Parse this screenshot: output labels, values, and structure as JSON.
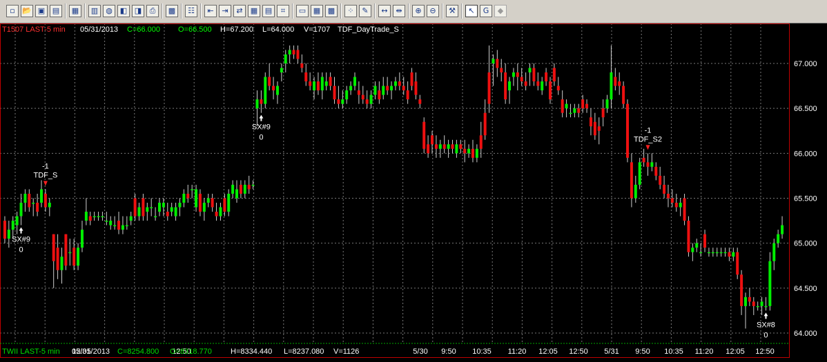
{
  "toolbar": {
    "icons": [
      {
        "name": "new-document-icon",
        "glyph": "▫"
      },
      {
        "name": "open-folder-icon",
        "glyph": "📂"
      },
      {
        "name": "save-workspace-icon",
        "glyph": "▣"
      },
      {
        "name": "workspace-folder-icon",
        "glyph": "▤"
      },
      {
        "name": "chart-window-icon",
        "glyph": "▦"
      },
      {
        "name": "bar-chart-icon",
        "glyph": "▥"
      },
      {
        "name": "globe-icon",
        "glyph": "◍"
      },
      {
        "name": "scanner-icon",
        "glyph": "◧"
      },
      {
        "name": "news-icon",
        "glyph": "◨"
      },
      {
        "name": "print-icon",
        "glyph": "⎙"
      },
      {
        "name": "chart-settings-icon",
        "glyph": "▩"
      },
      {
        "name": "properties-icon",
        "glyph": "☷"
      },
      {
        "name": "insert-indicator-icon",
        "glyph": "⇤"
      },
      {
        "name": "insert-strategy-icon",
        "glyph": "⇥"
      },
      {
        "name": "order-entry-icon",
        "glyph": "⇄"
      },
      {
        "name": "matrix-icon",
        "glyph": "▦"
      },
      {
        "name": "position-icon",
        "glyph": "▤"
      },
      {
        "name": "tools-icon",
        "glyph": "⌗"
      },
      {
        "name": "data-window-icon",
        "glyph": "▭"
      },
      {
        "name": "grid-view-icon",
        "glyph": "▦"
      },
      {
        "name": "spreadsheet-icon",
        "glyph": "▩"
      },
      {
        "name": "scatter-icon",
        "glyph": "⁘"
      },
      {
        "name": "drawing-tools-icon",
        "glyph": "✎"
      },
      {
        "name": "expand-bars-icon",
        "glyph": "↔"
      },
      {
        "name": "compress-bars-icon",
        "glyph": "⇹"
      },
      {
        "name": "zoom-in-icon",
        "glyph": "⊕"
      },
      {
        "name": "zoom-out-icon",
        "glyph": "⊖"
      },
      {
        "name": "hammer-tools-icon",
        "glyph": "⚒"
      },
      {
        "name": "pointer-icon",
        "glyph": "↖"
      },
      {
        "name": "global-cursor-icon",
        "glyph": "G"
      },
      {
        "name": "disabled-tool-icon",
        "glyph": "◆"
      }
    ]
  },
  "info_bar": {
    "symbol_interval": "T1507 LAST-5 min",
    "date": "05/31/2013",
    "close": "C=66.000",
    "open": "O=66.500",
    "high": "H=67.200",
    "low": "L=64.000",
    "volume": "V=1707",
    "strategy": "TDF_DayTrade_S"
  },
  "subchart_bar": {
    "symbol_interval": "TWII LAST-5 min",
    "date": "05/31/2013",
    "close": "C=8254.800",
    "open": "O=8318.770",
    "high": "H=8334.440",
    "low": "L=8237.080",
    "volume": "V=1126"
  },
  "colors": {
    "up_bar": "#00ee00",
    "down_bar": "#ee1010",
    "grid": "#7a7a7a",
    "frame": "#c00000",
    "info_red": "#ff3030",
    "info_green": "#00ff00",
    "subchart_text": "#00dd00"
  },
  "chart_data": {
    "type": "ohlc",
    "price_axis": {
      "ticks": [
        "67.000",
        "66.500",
        "66.000",
        "65.500",
        "65.000",
        "64.500",
        "64.000"
      ],
      "tick_values": [
        67.0,
        66.5,
        66.0,
        65.5,
        65.0,
        64.5,
        64.0
      ],
      "ylim": [
        63.9,
        67.55
      ]
    },
    "time_axis": {
      "ticks": [
        "12:05",
        "12:50",
        "5/30",
        "9:50",
        "10:35",
        "11:20",
        "12:05",
        "12:50",
        "5/31",
        "9:50",
        "10:35",
        "11:20",
        "12:05",
        "12:50"
      ]
    },
    "grid": true,
    "bars": [
      [
        65.25,
        65.3,
        65.0,
        65.05
      ],
      [
        65.05,
        65.25,
        64.95,
        65.15
      ],
      [
        65.15,
        65.3,
        65.05,
        65.25
      ],
      [
        65.2,
        65.35,
        65.1,
        65.3
      ],
      [
        65.3,
        65.55,
        65.2,
        65.45
      ],
      [
        65.45,
        65.6,
        65.35,
        65.55
      ],
      [
        65.55,
        65.6,
        65.35,
        65.4
      ],
      [
        65.45,
        65.5,
        65.3,
        65.45
      ],
      [
        65.45,
        65.55,
        65.3,
        65.35
      ],
      [
        65.45,
        65.7,
        65.4,
        65.6
      ],
      [
        65.55,
        65.6,
        65.35,
        65.4
      ],
      [
        65.4,
        65.5,
        65.3,
        65.45
      ],
      [
        65.1,
        65.1,
        64.5,
        64.8
      ],
      [
        64.95,
        65.1,
        64.6,
        64.7
      ],
      [
        64.7,
        64.95,
        64.55,
        64.85
      ],
      [
        65.1,
        65.1,
        64.7,
        64.75
      ],
      [
        64.9,
        65.05,
        64.75,
        64.9
      ],
      [
        64.95,
        65.05,
        64.7,
        64.75
      ],
      [
        64.75,
        65.0,
        64.7,
        64.95
      ],
      [
        64.95,
        65.25,
        64.9,
        65.15
      ],
      [
        65.25,
        65.5,
        65.2,
        65.35
      ],
      [
        65.3,
        65.35,
        65.2,
        65.25
      ],
      [
        65.3,
        65.35,
        65.25,
        65.3
      ],
      [
        65.3,
        65.35,
        65.25,
        65.3
      ],
      [
        65.3,
        65.35,
        65.25,
        65.3
      ],
      [
        65.25,
        65.35,
        65.2,
        65.25
      ],
      [
        65.2,
        65.3,
        65.15,
        65.25
      ],
      [
        65.2,
        65.3,
        65.15,
        65.2
      ],
      [
        65.25,
        65.35,
        65.1,
        65.15
      ],
      [
        65.15,
        65.3,
        65.1,
        65.2
      ],
      [
        65.2,
        65.3,
        65.15,
        65.2
      ],
      [
        65.25,
        65.35,
        65.2,
        65.3
      ],
      [
        65.5,
        65.55,
        65.25,
        65.3
      ],
      [
        65.3,
        65.45,
        65.25,
        65.4
      ],
      [
        65.5,
        65.55,
        65.25,
        65.3
      ],
      [
        65.35,
        65.45,
        65.25,
        65.4
      ],
      [
        65.4,
        65.5,
        65.3,
        65.4
      ],
      [
        65.3,
        65.4,
        65.25,
        65.3
      ],
      [
        65.35,
        65.5,
        65.3,
        65.45
      ],
      [
        65.4,
        65.5,
        65.3,
        65.45
      ],
      [
        65.35,
        65.45,
        65.25,
        65.3
      ],
      [
        65.35,
        65.45,
        65.3,
        65.4
      ],
      [
        65.3,
        65.45,
        65.25,
        65.4
      ],
      [
        65.4,
        65.5,
        65.3,
        65.45
      ],
      [
        65.45,
        65.6,
        65.4,
        65.55
      ],
      [
        65.55,
        65.65,
        65.45,
        65.5
      ],
      [
        65.6,
        65.65,
        65.5,
        65.6
      ],
      [
        65.4,
        65.65,
        65.35,
        65.6
      ],
      [
        65.55,
        65.6,
        65.3,
        65.35
      ],
      [
        65.35,
        65.5,
        65.25,
        65.45
      ],
      [
        65.45,
        65.55,
        65.4,
        65.5
      ],
      [
        65.5,
        65.55,
        65.35,
        65.4
      ],
      [
        65.35,
        65.45,
        65.25,
        65.3
      ],
      [
        65.3,
        65.45,
        65.25,
        65.4
      ],
      [
        65.5,
        65.55,
        65.3,
        65.35
      ],
      [
        65.35,
        65.6,
        65.3,
        65.55
      ],
      [
        65.55,
        65.7,
        65.5,
        65.65
      ],
      [
        65.5,
        65.7,
        65.45,
        65.6
      ],
      [
        65.65,
        65.7,
        65.5,
        65.55
      ],
      [
        65.55,
        65.7,
        65.5,
        65.65
      ],
      [
        65.65,
        65.75,
        65.55,
        65.6
      ],
      [
        65.65,
        65.7,
        65.6,
        65.65
      ],
      [
        66.5,
        66.7,
        66.3,
        66.6
      ],
      [
        66.6,
        66.7,
        66.45,
        66.55
      ],
      [
        66.55,
        66.9,
        66.5,
        66.85
      ],
      [
        66.85,
        67.0,
        66.7,
        66.75
      ],
      [
        66.75,
        66.85,
        66.6,
        66.7
      ],
      [
        66.65,
        66.8,
        66.55,
        66.75
      ],
      [
        66.9,
        67.0,
        66.8,
        66.95
      ],
      [
        67.0,
        67.15,
        66.9,
        67.1
      ],
      [
        67.1,
        67.2,
        67.0,
        67.15
      ],
      [
        67.15,
        67.2,
        67.05,
        67.1
      ],
      [
        67.15,
        67.2,
        67.0,
        67.05
      ],
      [
        67.0,
        67.1,
        66.9,
        66.95
      ],
      [
        66.9,
        67.0,
        66.75,
        66.8
      ],
      [
        66.8,
        66.9,
        66.7,
        66.75
      ],
      [
        66.7,
        66.85,
        66.6,
        66.8
      ],
      [
        66.8,
        66.9,
        66.65,
        66.7
      ],
      [
        66.7,
        66.9,
        66.6,
        66.85
      ],
      [
        66.75,
        66.9,
        66.7,
        66.8
      ],
      [
        66.85,
        66.9,
        66.7,
        66.75
      ],
      [
        66.75,
        66.85,
        66.55,
        66.6
      ],
      [
        66.6,
        66.75,
        66.5,
        66.55
      ],
      [
        66.55,
        66.7,
        66.5,
        66.6
      ],
      [
        66.6,
        66.75,
        66.55,
        66.7
      ],
      [
        66.7,
        66.8,
        66.65,
        66.75
      ],
      [
        66.75,
        66.9,
        66.7,
        66.85
      ],
      [
        66.7,
        66.8,
        66.55,
        66.65
      ],
      [
        66.65,
        66.75,
        66.55,
        66.6
      ],
      [
        66.6,
        66.7,
        66.5,
        66.55
      ],
      [
        66.55,
        66.7,
        66.5,
        66.65
      ],
      [
        66.65,
        66.8,
        66.6,
        66.75
      ],
      [
        66.7,
        66.8,
        66.55,
        66.6
      ],
      [
        66.65,
        66.85,
        66.6,
        66.75
      ],
      [
        66.75,
        66.85,
        66.65,
        66.7
      ],
      [
        66.7,
        66.8,
        66.6,
        66.75
      ],
      [
        66.75,
        66.85,
        66.7,
        66.8
      ],
      [
        66.8,
        66.9,
        66.7,
        66.75
      ],
      [
        66.75,
        66.85,
        66.65,
        66.7
      ],
      [
        66.7,
        66.8,
        66.55,
        66.6
      ],
      [
        66.9,
        66.95,
        66.7,
        66.75
      ],
      [
        66.8,
        66.9,
        66.6,
        66.65
      ],
      [
        66.6,
        66.65,
        66.5,
        66.55
      ],
      [
        66.35,
        66.4,
        66.0,
        66.05
      ],
      [
        66.1,
        66.2,
        65.95,
        66.0
      ],
      [
        66.2,
        66.25,
        66.0,
        66.1
      ],
      [
        66.1,
        66.2,
        65.95,
        66.05
      ],
      [
        66.05,
        66.15,
        65.95,
        66.1
      ],
      [
        66.1,
        66.2,
        66.0,
        66.05
      ],
      [
        66.05,
        66.15,
        65.95,
        66.1
      ],
      [
        66.1,
        66.15,
        66.0,
        66.05
      ],
      [
        66.0,
        66.15,
        65.95,
        66.1
      ],
      [
        66.1,
        66.15,
        66.0,
        66.05
      ],
      [
        66.05,
        66.15,
        65.9,
        66.0
      ],
      [
        66.0,
        66.1,
        65.95,
        66.05
      ],
      [
        66.05,
        66.15,
        65.9,
        65.95
      ],
      [
        65.95,
        66.1,
        65.9,
        66.05
      ],
      [
        66.2,
        66.35,
        65.95,
        66.05
      ],
      [
        66.45,
        66.6,
        66.15,
        66.2
      ],
      [
        66.9,
        67.2,
        66.45,
        66.55
      ],
      [
        67.0,
        67.1,
        66.75,
        67.05
      ],
      [
        67.05,
        67.15,
        66.85,
        66.95
      ],
      [
        66.95,
        67.05,
        66.8,
        66.9
      ],
      [
        66.9,
        67.0,
        66.55,
        66.6
      ],
      [
        66.7,
        66.85,
        66.55,
        66.8
      ],
      [
        66.85,
        66.95,
        66.75,
        66.9
      ],
      [
        66.9,
        67.0,
        66.7,
        66.85
      ],
      [
        66.85,
        66.95,
        66.75,
        66.8
      ],
      [
        66.8,
        66.9,
        66.7,
        66.75
      ],
      [
        66.9,
        67.0,
        66.75,
        66.95
      ],
      [
        66.95,
        67.0,
        66.75,
        66.8
      ],
      [
        66.8,
        66.9,
        66.7,
        66.75
      ],
      [
        66.7,
        66.85,
        66.65,
        66.8
      ],
      [
        66.9,
        66.95,
        66.75,
        66.8
      ],
      [
        66.8,
        66.85,
        66.55,
        66.6
      ],
      [
        66.95,
        67.0,
        66.75,
        66.8
      ],
      [
        66.75,
        66.85,
        66.65,
        66.7
      ],
      [
        66.6,
        66.7,
        66.4,
        66.45
      ],
      [
        66.5,
        66.6,
        66.4,
        66.55
      ],
      [
        66.45,
        66.55,
        66.4,
        66.45
      ],
      [
        66.45,
        66.55,
        66.4,
        66.5
      ],
      [
        66.5,
        66.55,
        66.4,
        66.45
      ],
      [
        66.6,
        66.65,
        66.45,
        66.5
      ],
      [
        66.55,
        66.6,
        66.45,
        66.5
      ],
      [
        66.4,
        66.5,
        66.2,
        66.3
      ],
      [
        66.35,
        66.45,
        66.15,
        66.2
      ],
      [
        66.3,
        66.4,
        66.1,
        66.25
      ],
      [
        66.5,
        66.6,
        66.3,
        66.4
      ],
      [
        66.5,
        66.65,
        66.45,
        66.6
      ],
      [
        66.6,
        67.2,
        66.5,
        66.9
      ],
      [
        66.85,
        66.95,
        66.7,
        66.75
      ],
      [
        66.8,
        66.9,
        66.65,
        66.75
      ],
      [
        66.75,
        66.8,
        66.5,
        66.55
      ],
      [
        66.55,
        66.6,
        65.9,
        65.95
      ],
      [
        65.9,
        66.0,
        65.4,
        65.5
      ],
      [
        65.5,
        65.75,
        65.45,
        65.65
      ],
      [
        65.65,
        65.95,
        65.6,
        65.9
      ],
      [
        65.95,
        66.05,
        65.85,
        65.9
      ],
      [
        65.9,
        66.0,
        65.75,
        65.85
      ],
      [
        65.85,
        66.0,
        65.8,
        65.9
      ],
      [
        65.85,
        65.9,
        65.7,
        65.75
      ],
      [
        65.75,
        65.85,
        65.6,
        65.65
      ],
      [
        65.65,
        65.75,
        65.5,
        65.55
      ],
      [
        65.55,
        65.65,
        65.4,
        65.5
      ],
      [
        65.5,
        65.6,
        65.4,
        65.45
      ],
      [
        65.45,
        65.55,
        65.35,
        65.4
      ],
      [
        65.4,
        65.5,
        65.3,
        65.45
      ],
      [
        65.5,
        65.55,
        65.2,
        65.25
      ],
      [
        65.25,
        65.3,
        64.85,
        64.9
      ],
      [
        64.9,
        65.0,
        64.8,
        64.95
      ],
      [
        64.95,
        65.05,
        64.9,
        65.0
      ],
      [
        64.9,
        65.0,
        64.85,
        64.9
      ],
      [
        65.1,
        65.15,
        64.9,
        64.95
      ],
      [
        64.9,
        64.95,
        64.85,
        64.9
      ],
      [
        64.9,
        64.95,
        64.85,
        64.9
      ],
      [
        64.9,
        64.95,
        64.85,
        64.9
      ],
      [
        64.9,
        64.95,
        64.85,
        64.9
      ],
      [
        64.9,
        64.95,
        64.85,
        64.9
      ],
      [
        64.9,
        64.95,
        64.8,
        64.85
      ],
      [
        64.85,
        64.95,
        64.8,
        64.9
      ],
      [
        64.9,
        64.95,
        64.6,
        64.65
      ],
      [
        64.65,
        64.7,
        64.2,
        64.3
      ],
      [
        64.3,
        64.45,
        64.05,
        64.4
      ],
      [
        64.4,
        64.5,
        64.3,
        64.35
      ],
      [
        64.35,
        64.4,
        64.2,
        64.3
      ],
      [
        64.3,
        64.35,
        64.25,
        64.3
      ],
      [
        64.3,
        64.4,
        64.2,
        64.35
      ],
      [
        64.3,
        64.4,
        64.25,
        64.3
      ],
      [
        64.3,
        64.9,
        64.25,
        64.8
      ],
      [
        64.8,
        65.05,
        64.7,
        65.0
      ],
      [
        65.0,
        65.15,
        64.95,
        65.1
      ],
      [
        65.1,
        65.3,
        65.05,
        65.2
      ]
    ],
    "annotations": [
      {
        "bar": 10,
        "label": "-1",
        "label2": "TDF_S",
        "kind": "entry"
      },
      {
        "bar": 4,
        "label": "SX#9",
        "label2": "0",
        "kind": "exit"
      },
      {
        "bar": 63,
        "label": "SX#9",
        "label2": "0",
        "kind": "exit"
      },
      {
        "bar": 158,
        "label": "-1",
        "label2": "TDF_S2",
        "kind": "entry"
      },
      {
        "bar": 187,
        "label": "SX#8",
        "label2": "0",
        "kind": "exit"
      }
    ]
  }
}
